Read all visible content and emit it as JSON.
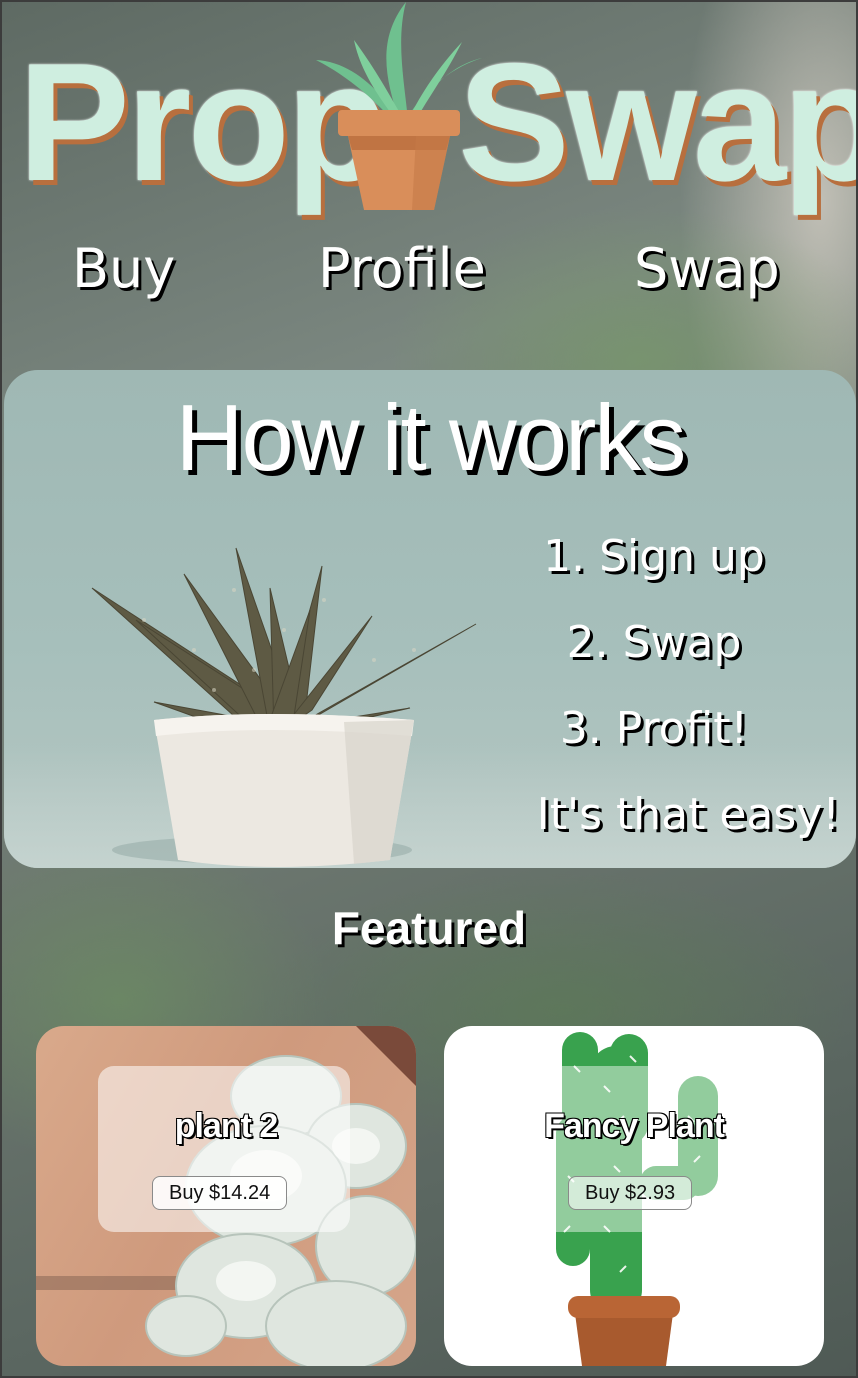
{
  "logo": {
    "left_text": "Prop",
    "right_text": "Swap"
  },
  "nav": {
    "buy": "Buy",
    "profile": "Profile",
    "swap": "Swap"
  },
  "how_it_works": {
    "title": "How it works",
    "steps": [
      "1. Sign up",
      "2. Swap",
      "3. Profit!",
      "It's that easy!"
    ]
  },
  "featured": {
    "title": "Featured",
    "cards": [
      {
        "name": "plant 2",
        "button": "Buy $14.24"
      },
      {
        "name": "Fancy Plant",
        "button": "Buy $2.93"
      }
    ]
  },
  "colors": {
    "logo_text": "#cfeee0",
    "logo_shadow": "#b86f3e",
    "pot": "#d78c59",
    "leaf": "#6fc08f",
    "panel": "#a6bfbb"
  }
}
